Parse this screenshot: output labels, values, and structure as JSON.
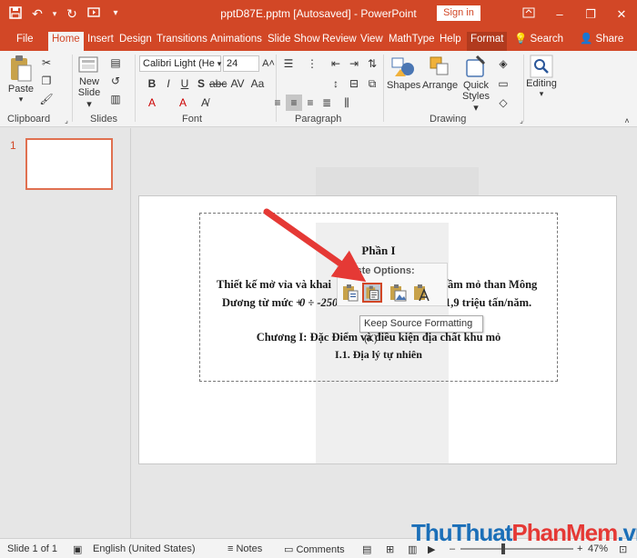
{
  "window": {
    "title": "pptD87E.pptm [Autosaved]  -  PowerPoint",
    "sign_in": "Sign in",
    "icons": [
      "save-icon",
      "undo-icon",
      "redo-icon",
      "customize-qat-icon",
      "ribbon-display-icon",
      "minimize-icon",
      "restore-icon",
      "close-icon"
    ]
  },
  "tabs": [
    {
      "label": "File"
    },
    {
      "label": "Home"
    },
    {
      "label": "Insert"
    },
    {
      "label": "Design"
    },
    {
      "label": "Transitions"
    },
    {
      "label": "Animations"
    },
    {
      "label": "Slide Show"
    },
    {
      "label": "Review"
    },
    {
      "label": "View"
    },
    {
      "label": "MathType"
    },
    {
      "label": "Help"
    },
    {
      "label": "Format"
    }
  ],
  "active_tab": "Home",
  "tell_me": "Search",
  "share": "Share",
  "ribbon": {
    "clipboard": {
      "label": "Clipboard",
      "paste": "Paste"
    },
    "slides": {
      "label": "Slides",
      "new_slide_1": "New",
      "new_slide_2": "Slide"
    },
    "font": {
      "label": "Font",
      "family": "Calibri Light (He",
      "size": "24"
    },
    "paragraph": {
      "label": "Paragraph"
    },
    "drawing": {
      "label": "Drawing",
      "shapes": "Shapes",
      "arrange": "Arrange",
      "quick_styles_1": "Quick",
      "quick_styles_2": "Styles"
    },
    "editing": {
      "label": "Editing"
    }
  },
  "thumbnails": [
    {
      "number": "1"
    }
  ],
  "slide_text": {
    "heading": "Phần I",
    "line1_left": "Thiết kế mở vỉa và khai",
    "line1_right": "ầm mỏ than Mông",
    "line2_left": "Dương từ mức +",
    "line2_mid": "0 ÷ -250",
    "line2_right": "1,9 triệu tấn/năm.",
    "chapter": "Chương I: Đặc Điểm và điều kiện địa chất khu mỏ",
    "section": "I.1. Địa lý tự  nhiên"
  },
  "paste_options": {
    "title": "Paste Options:",
    "tooltip": "Keep Source Formatting (K)",
    "buttons": [
      "use-destination-theme",
      "keep-source-formatting",
      "picture",
      "keep-text-only"
    ]
  },
  "status": {
    "slide_info": "Slide 1 of 1",
    "language": "English (United States)",
    "notes": "Notes",
    "comments": "Comments",
    "zoom": "47%"
  },
  "watermark": {
    "part1": "ThuThuat",
    "part2": "PhanMem",
    "part3": ".vn"
  },
  "colors": {
    "accent": "#d24726",
    "tab_active_text": "#d24726",
    "highlight": "#d24726"
  }
}
